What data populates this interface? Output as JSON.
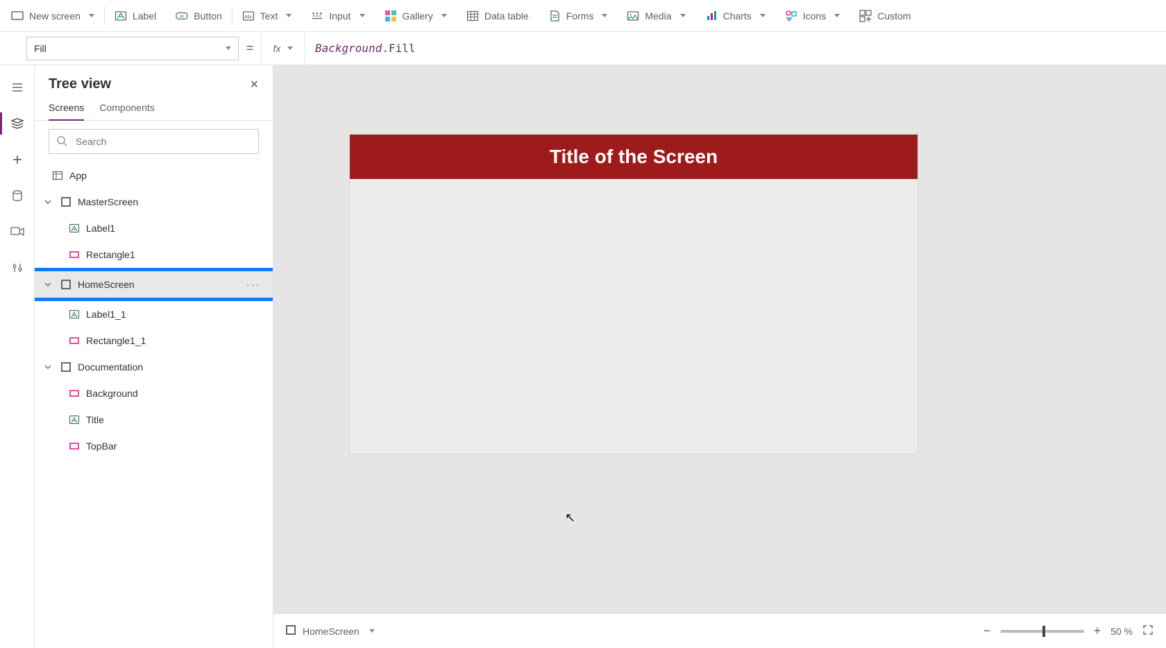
{
  "ribbon": {
    "new_screen": "New screen",
    "label": "Label",
    "button": "Button",
    "text": "Text",
    "input": "Input",
    "gallery": "Gallery",
    "data_table": "Data table",
    "forms": "Forms",
    "media": "Media",
    "charts": "Charts",
    "icons": "Icons",
    "custom": "Custom"
  },
  "formula": {
    "property": "Fill",
    "fx": "fx",
    "equals": "=",
    "token_object": "Background",
    "token_dot": ".",
    "token_prop": "Fill"
  },
  "tree": {
    "title": "Tree view",
    "tab_screens": "Screens",
    "tab_components": "Components",
    "search_placeholder": "Search",
    "nodes": {
      "app": "App",
      "master": "MasterScreen",
      "label1": "Label1",
      "rectangle1": "Rectangle1",
      "home": "HomeScreen",
      "label1_1": "Label1_1",
      "rectangle1_1": "Rectangle1_1",
      "documentation": "Documentation",
      "background": "Background",
      "title": "Title",
      "topbar": "TopBar"
    },
    "more": "···"
  },
  "preview": {
    "title": "Title of the Screen"
  },
  "status": {
    "screen": "HomeScreen",
    "zoom_minus": "−",
    "zoom_plus": "+",
    "zoom_value": "50 %"
  }
}
